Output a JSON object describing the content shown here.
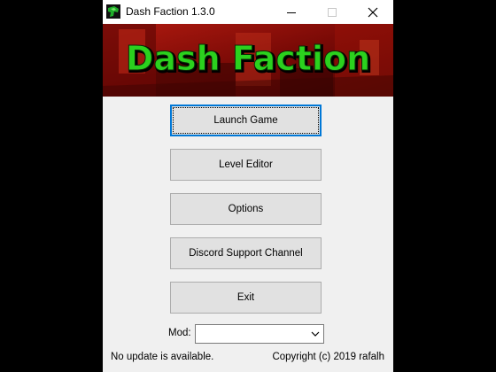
{
  "window": {
    "title": "Dash Faction 1.3.0"
  },
  "titlebar": {
    "minimize_icon": "minimize-icon",
    "maximize_icon": "maximize-icon",
    "close_icon": "close-icon"
  },
  "banner": {
    "logo_text": "Dash Faction",
    "logo_color": "#2bd11e",
    "background_color": "#8c0c08"
  },
  "buttons": {
    "launch": "Launch Game",
    "editor": "Level Editor",
    "options": "Options",
    "discord": "Discord Support Channel",
    "exit": "Exit"
  },
  "mod": {
    "label": "Mod:",
    "value": ""
  },
  "footer": {
    "status": "No update is available.",
    "copyright": "Copyright (c) 2019 rafalh"
  },
  "colors": {
    "accent": "#0078d7",
    "button_face": "#e1e1e1",
    "window_bg": "#f0f0f0"
  }
}
